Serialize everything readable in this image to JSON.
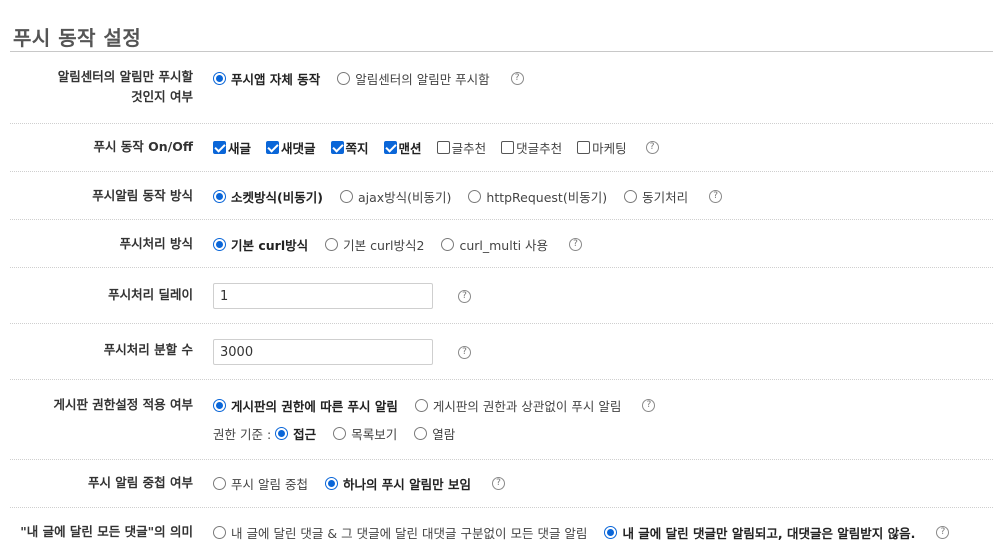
{
  "title": "푸시 동작 설정",
  "help_glyph": "?",
  "rows": {
    "center_only": {
      "label_l1": "알림센터의 알림만 푸시할",
      "label_l2": "것인지 여부",
      "options": [
        "푸시앱 자체 동작",
        "알림센터의 알림만 푸시함"
      ],
      "selected": 0
    },
    "onoff": {
      "label": "푸시 동작 On/Off",
      "checks": [
        {
          "label": "새글",
          "checked": true
        },
        {
          "label": "새댓글",
          "checked": true
        },
        {
          "label": "쪽지",
          "checked": true
        },
        {
          "label": "맨션",
          "checked": true
        },
        {
          "label": "글추천",
          "checked": false
        },
        {
          "label": "댓글추천",
          "checked": false
        },
        {
          "label": "마케팅",
          "checked": false
        }
      ]
    },
    "method": {
      "label": "푸시알림 동작 방식",
      "options": [
        "소켓방식(비동기)",
        "ajax방식(비동기)",
        "httpRequest(비동기)",
        "동기처리"
      ],
      "selected": 0
    },
    "process": {
      "label": "푸시처리 방식",
      "options": [
        "기본 curl방식",
        "기본 curl방식2",
        "curl_multi 사용"
      ],
      "selected": 0
    },
    "delay": {
      "label": "푸시처리 딜레이",
      "value": "1"
    },
    "split": {
      "label": "푸시처리 분할 수",
      "value": "3000"
    },
    "board_perm": {
      "label": "게시판 권한설정 적용 여부",
      "options": [
        "게시판의 권한에 따른 푸시 알림",
        "게시판의 권한과 상관없이 푸시 알림"
      ],
      "selected": 0,
      "sub_label": "권한 기준 :",
      "sub_options": [
        "접근",
        "목록보기",
        "열람"
      ],
      "sub_selected": 0
    },
    "overlap": {
      "label": "푸시 알림 중첩 여부",
      "options": [
        "푸시 알림 중첩",
        "하나의 푸시 알림만 보임"
      ],
      "selected": 1
    },
    "comment_meaning": {
      "label": "\"내 글에 달린 모든 댓글\"의 의미",
      "options": [
        "내 글에 달린 댓글 & 그 댓글에 달린 대댓글 구분없이 모든 댓글 알림",
        "내 글에 달린 댓글만 알림되고, 대댓글은 알림받지 않음."
      ],
      "selected": 1
    }
  }
}
